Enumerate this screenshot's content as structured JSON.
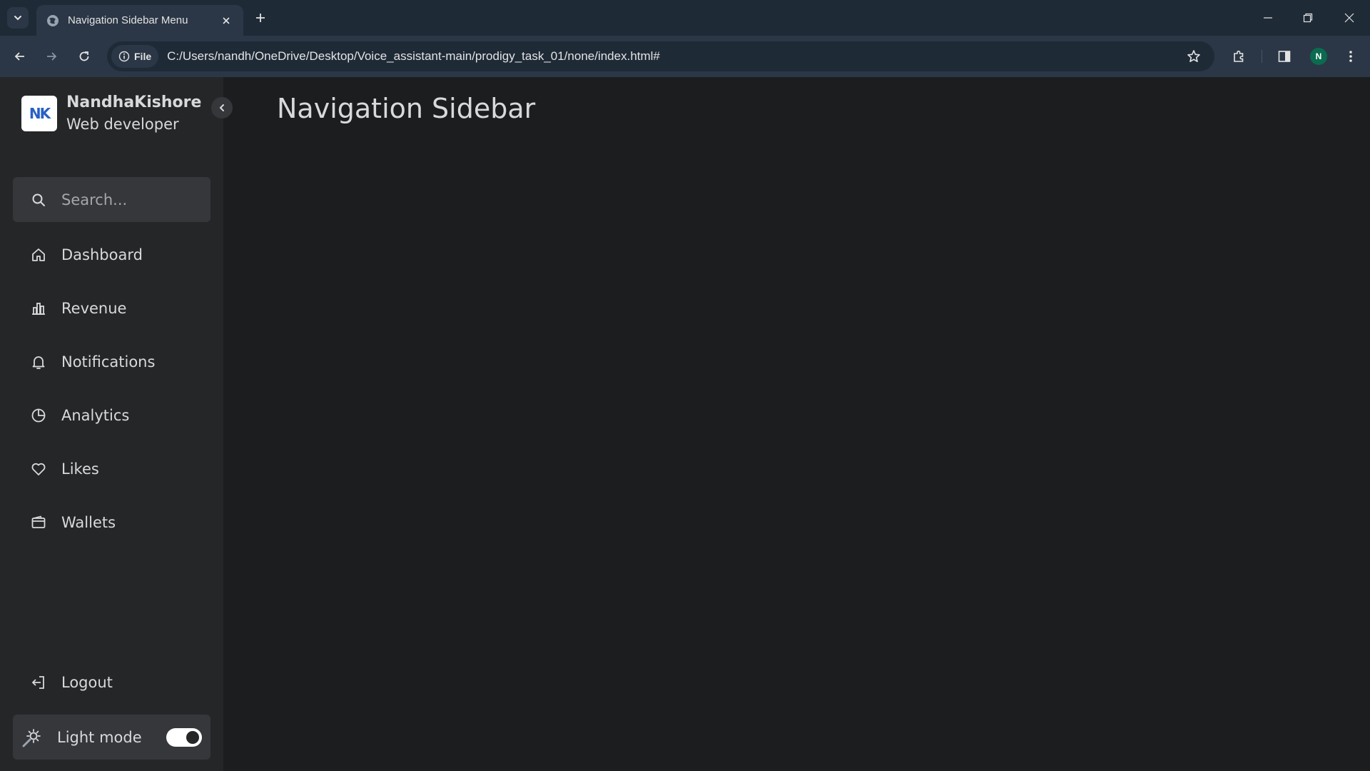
{
  "browser": {
    "tab_title": "Navigation Sidebar Menu",
    "site_chip": "File",
    "url": "C:/Users/nandh/OneDrive/Desktop/Voice_assistant-main/prodigy_task_01/none/index.html#",
    "profile_initial": "N"
  },
  "sidebar": {
    "logo_text": "NK",
    "brand_name": "NandhaKishore",
    "brand_role": "Web developer",
    "search_placeholder": "Search...",
    "items": [
      {
        "label": "Dashboard",
        "icon": "home-icon"
      },
      {
        "label": "Revenue",
        "icon": "bar-chart-icon"
      },
      {
        "label": "Notifications",
        "icon": "bell-icon"
      },
      {
        "label": "Analytics",
        "icon": "pie-chart-icon"
      },
      {
        "label": "Likes",
        "icon": "heart-icon"
      },
      {
        "label": "Wallets",
        "icon": "wallet-icon"
      }
    ],
    "logout_label": "Logout",
    "mode_label": "Light mode",
    "mode_toggle_on": true
  },
  "main": {
    "title": "Navigation Sidebar"
  },
  "colors": {
    "page_bg": "#1c1d1f",
    "sidebar_bg": "#252628",
    "surface": "#35373a",
    "text": "#d8d9db",
    "logo_accent": "#2760c4"
  }
}
